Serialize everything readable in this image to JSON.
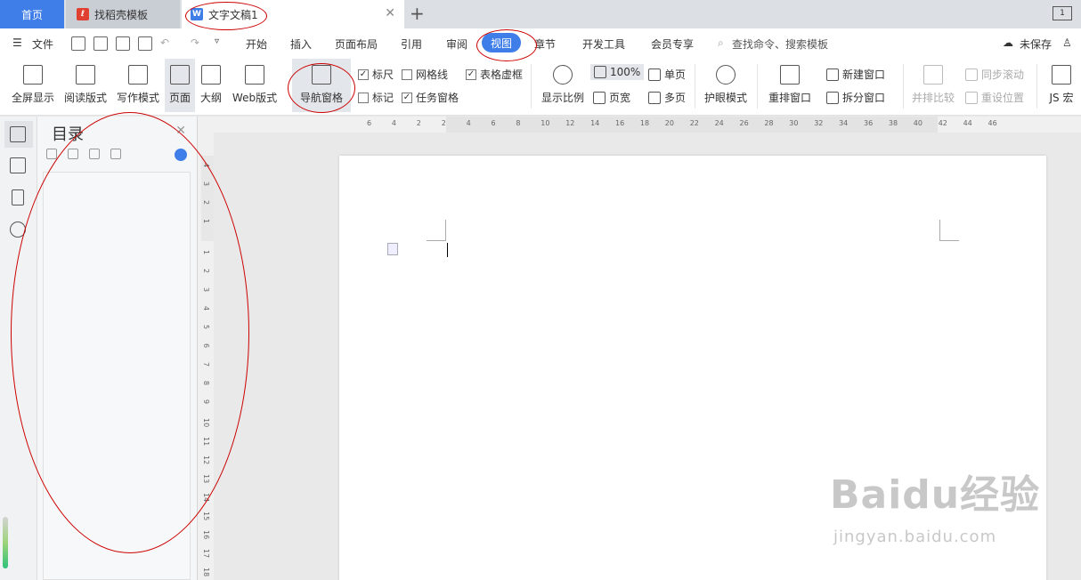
{
  "tabs": {
    "home": "首页",
    "template": "找稻壳模板",
    "document": "文字文稿1",
    "win": "1"
  },
  "menu": {
    "file": "文件",
    "start": "开始",
    "insert": "插入",
    "layout": "页面布局",
    "reference": "引用",
    "review": "审阅",
    "view": "视图",
    "chapter": "章节",
    "devtools": "开发工具",
    "member": "会员专享",
    "search": "查找命令、搜索模板",
    "unsaved": "未保存"
  },
  "ribbon": {
    "fullscreen": "全屏显示",
    "read": "阅读版式",
    "write": "写作模式",
    "page": "页面",
    "outline": "大纲",
    "web": "Web版式",
    "navpane": "导航窗格",
    "ruler": "标尺",
    "gridline": "网格线",
    "tablegrid": "表格虚框",
    "mark": "标记",
    "taskpane": "任务窗格",
    "zoom": "显示比例",
    "zoom100": "100%",
    "pagewidth": "页宽",
    "single": "单页",
    "multi": "多页",
    "eyecare": "护眼模式",
    "rearrange": "重排窗口",
    "newwindow": "新建窗口",
    "splitwindow": "拆分窗口",
    "compare": "并排比较",
    "syncscroll": "同步滚动",
    "resetpos": "重设位置",
    "macro": "JS 宏"
  },
  "nav": {
    "title": "目录"
  },
  "hruler": [
    "6",
    "4",
    "2",
    "2",
    "4",
    "6",
    "8",
    "10",
    "12",
    "14",
    "16",
    "18",
    "20",
    "22",
    "24",
    "26",
    "28",
    "30",
    "32",
    "34",
    "36",
    "38",
    "40",
    "42",
    "44",
    "46"
  ],
  "vruler": [
    "4",
    "3",
    "2",
    "1",
    "1",
    "2",
    "3",
    "4",
    "5",
    "6",
    "7",
    "8",
    "9",
    "10",
    "11",
    "12",
    "13",
    "14",
    "15",
    "16",
    "17",
    "18"
  ],
  "watermark": {
    "logo": "Baidu经验",
    "url": "jingyan.baidu.com"
  }
}
